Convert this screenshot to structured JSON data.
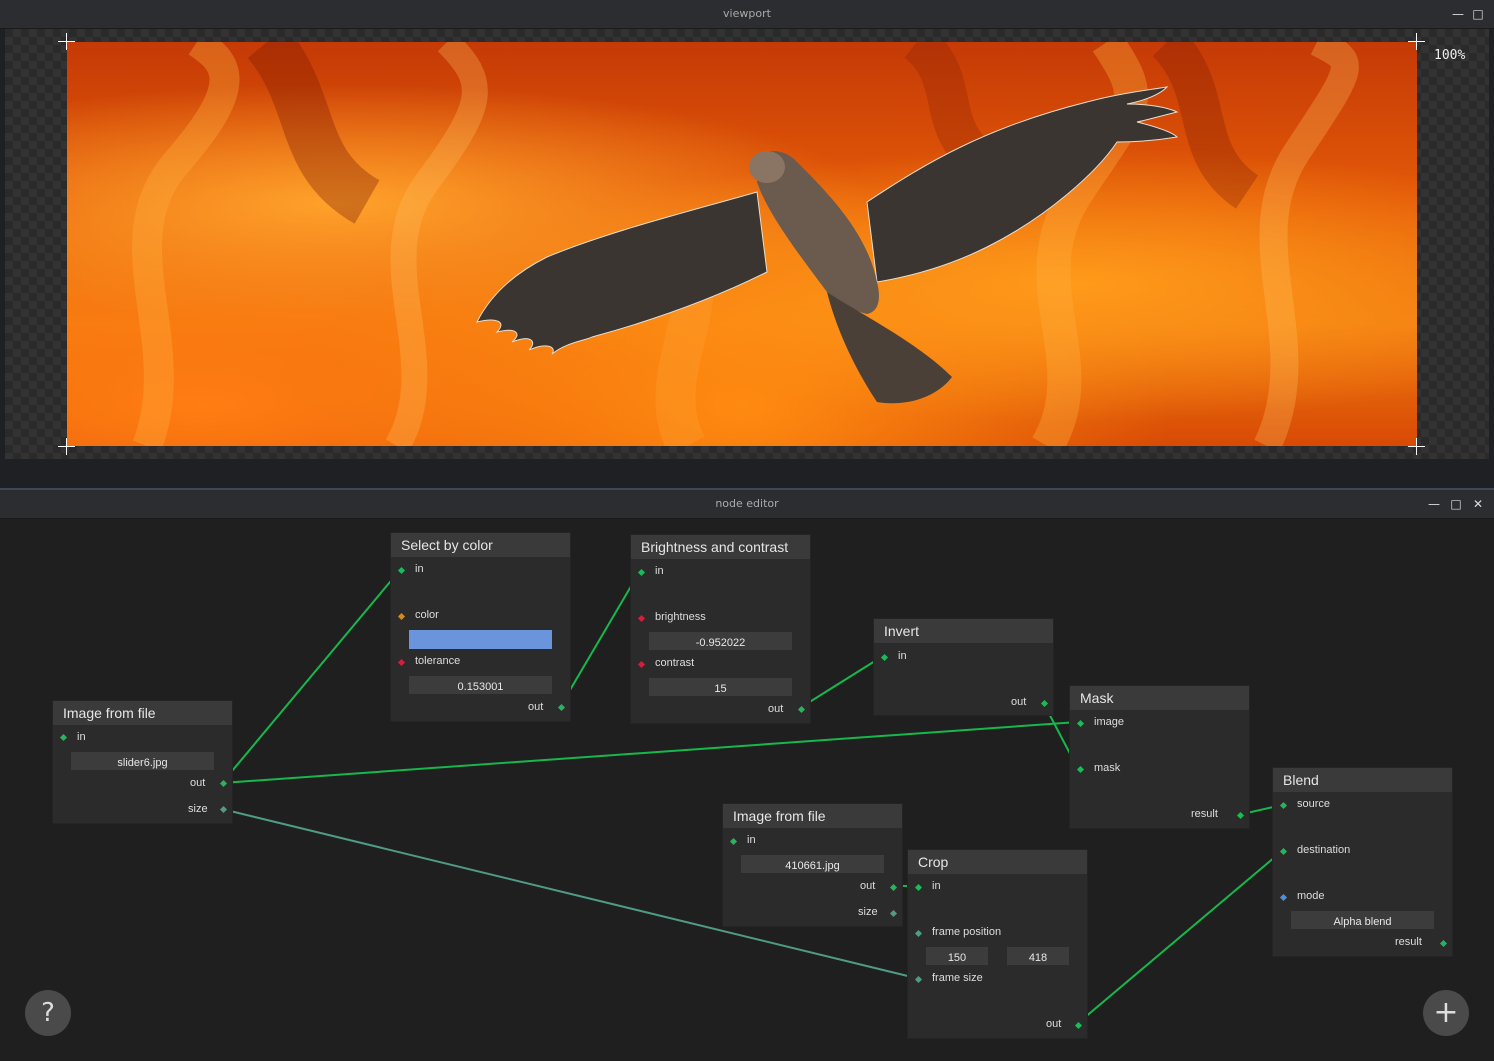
{
  "viewport": {
    "title": "viewport",
    "zoom": "100%",
    "image_description_icon": "hawk-over-fire-image"
  },
  "editor": {
    "title": "node editor",
    "help_label": "?",
    "add_label": "+"
  },
  "nodes": {
    "image1": {
      "title": "Image from file",
      "in": "in",
      "file": "slider6.jpg",
      "out": "out",
      "size": "size"
    },
    "select": {
      "title": "Select by color",
      "in": "in",
      "color": "color",
      "color_value": "#6a95dc",
      "tolerance": "tolerance",
      "tolerance_value": "0.153001",
      "out": "out"
    },
    "bc": {
      "title": "Brightness and contrast",
      "in": "in",
      "brightness": "brightness",
      "brightness_value": "-0.952022",
      "contrast": "contrast",
      "contrast_value": "15",
      "out": "out"
    },
    "invert": {
      "title": "Invert",
      "in": "in",
      "out": "out"
    },
    "mask": {
      "title": "Mask",
      "image": "image",
      "mask": "mask",
      "result": "result"
    },
    "image2": {
      "title": "Image from file",
      "in": "in",
      "file": "410661.jpg",
      "out": "out",
      "size": "size"
    },
    "crop": {
      "title": "Crop",
      "in": "in",
      "frame_position": "frame position",
      "pos_x": "150",
      "pos_y": "418",
      "frame_size": "frame size",
      "out": "out"
    },
    "blend": {
      "title": "Blend",
      "source": "source",
      "destination": "destination",
      "mode": "mode",
      "mode_value": "Alpha blend",
      "result": "result"
    }
  },
  "colors": {
    "wire": "#16b84c",
    "wire_size": "#4f9b86",
    "port_green": "#1fb85a",
    "port_red": "#d02040",
    "port_orange": "#d08a20",
    "port_blue": "#4a90e0"
  }
}
